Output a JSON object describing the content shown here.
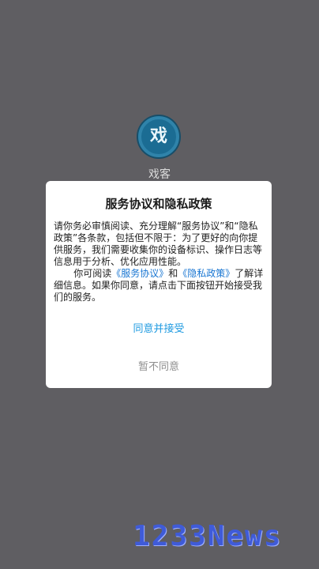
{
  "app": {
    "logo_glyph": "戏",
    "name": "戏客"
  },
  "dialog": {
    "title": "服务协议和隐私政策",
    "paragraph1": "请你务必审慎阅读、充分理解“服务协议”和“隐私政策”各条款，包括但不限于：为了更好的向你提供服务，我们需要收集你的设备标识、操作日志等信息用于分析、优化应用性能。",
    "paragraph2_prefix": "你可阅读",
    "service_agreement_link": "《服务协议》",
    "paragraph2_middle": "和",
    "privacy_policy_link": "《隐私政策》",
    "paragraph2_suffix": "了解详细信息。如果你同意，请点击下面按钮开始接受我们的服务。",
    "agree_label": "同意并接受",
    "disagree_label": "暂不同意"
  },
  "watermark": {
    "text": "1233News"
  },
  "colors": {
    "background": "#5f5e62",
    "link": "#1976d2",
    "agree": "#1e9ae0",
    "disagree": "#8e8e8e"
  }
}
